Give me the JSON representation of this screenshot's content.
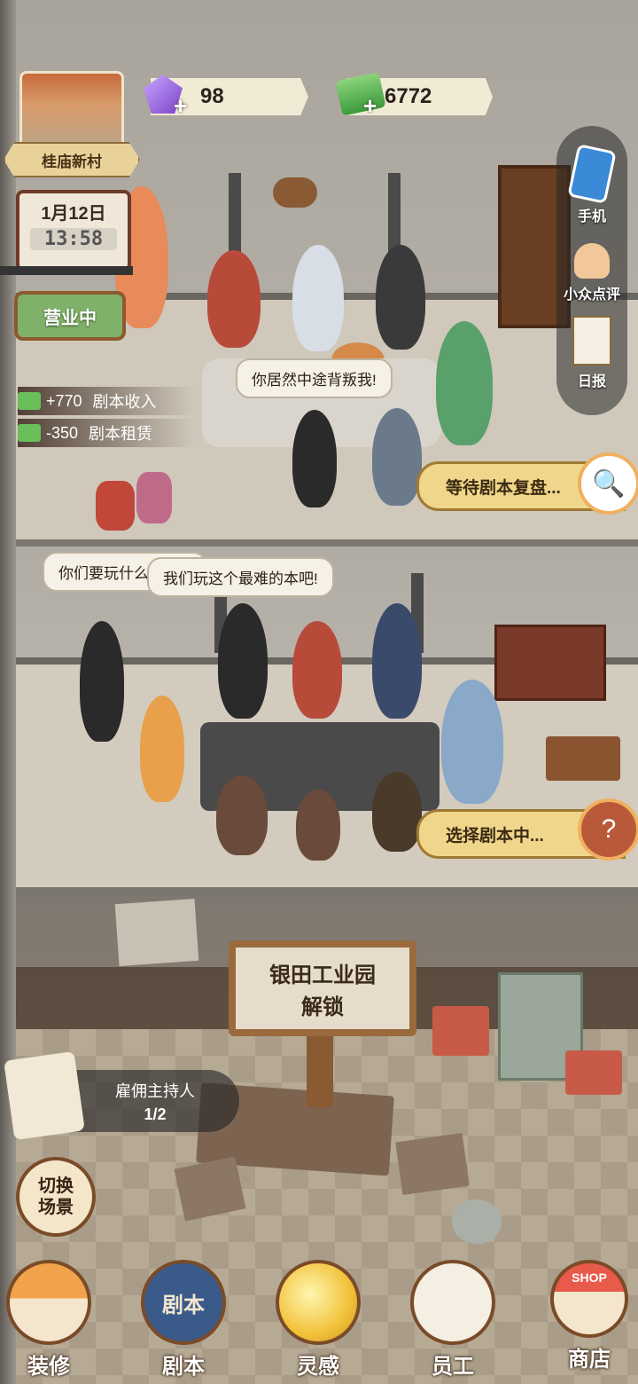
{
  "hud": {
    "location_name": "桂庙新村",
    "gems": "98",
    "cash": "6772",
    "plus_sign": "+",
    "date": "1月12日",
    "time": "13:58",
    "business_status": "营业中"
  },
  "ledger": [
    {
      "amount": "+770",
      "label": "剧本收入"
    },
    {
      "amount": "-350",
      "label": "剧本租赁"
    }
  ],
  "sidebar": {
    "phone": "手机",
    "reviews": "小众点评",
    "daily": "日报"
  },
  "room1": {
    "speech": "你居然中途背叛我!",
    "status": "等待剧本复盘..."
  },
  "room2": {
    "speech1": "你们要玩什么",
    "speech2": "我们玩这个最难的本吧!",
    "status": "选择剧本中..."
  },
  "room3": {
    "unlock_line1": "银田工业园",
    "unlock_line2": "解锁"
  },
  "host": {
    "label": "雇佣主持人",
    "count": "1/2"
  },
  "switch_scene": {
    "line1": "切换",
    "line2": "场景"
  },
  "nav": [
    {
      "label": "装修",
      "icon": "house-icon"
    },
    {
      "label": "剧本",
      "icon": "script-book-icon"
    },
    {
      "label": "灵感",
      "icon": "lightbulb-icon"
    },
    {
      "label": "员工",
      "icon": "staff-badge-icon"
    },
    {
      "label": "商店",
      "icon": "shop-icon"
    }
  ],
  "shop_sign": "SHOP",
  "book_cover_text": "剧本",
  "colors": {
    "wood": "#7a4b28",
    "status_pill": "#f0d68a",
    "open_sign": "#7fb16a"
  }
}
